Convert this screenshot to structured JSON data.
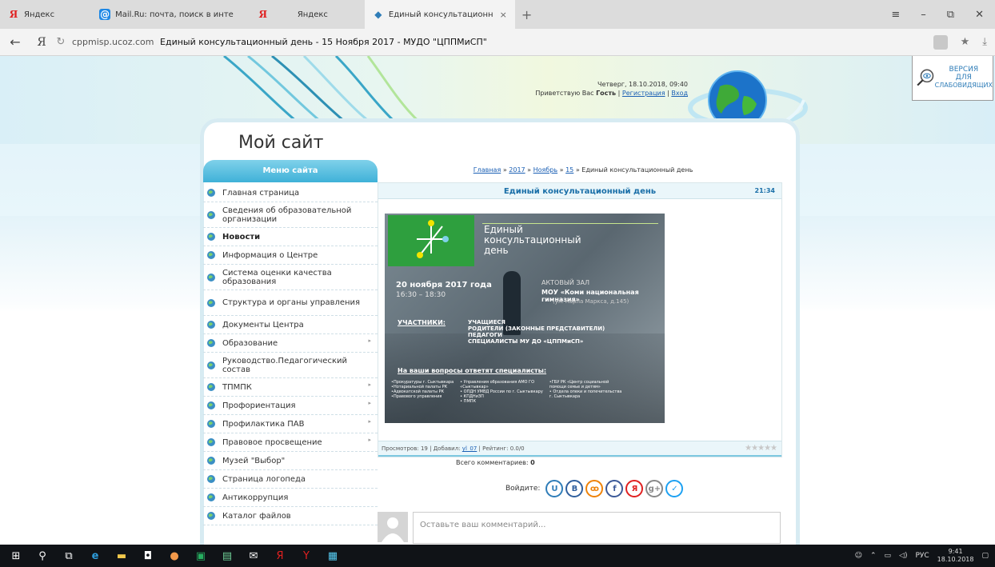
{
  "browser": {
    "tabs": [
      {
        "label": "Яндекс",
        "favicon": "yandex-icon",
        "active": false
      },
      {
        "label": "Mail.Ru: почта, поиск в инте",
        "favicon": "mailru-icon",
        "active": false
      },
      {
        "label": "Яндекс",
        "favicon": "yandex-icon",
        "active": false
      },
      {
        "label": "Единый консультационн",
        "favicon": "site-icon",
        "active": true
      }
    ],
    "address": {
      "domain": "cppmisp.ucoz.com",
      "page_title": "Единый консультационный день - 15 Ноября 2017 - МУДО \"ЦППМиСП\""
    },
    "controls": {
      "menu": "≡",
      "minimize": "–",
      "restore": "⧉",
      "close": "✕",
      "back": "←",
      "ya": "Я",
      "reload": "↻",
      "star": "★",
      "download": "⤓",
      "newtab": "+",
      "tabclose": "×"
    }
  },
  "header": {
    "datetime": "Четверг, 18.10.2018, 09:40",
    "greeting_prefix": "Приветствую Вас",
    "user": "Гость",
    "register": "Регистрация",
    "separator": "|",
    "login": "Вход",
    "vision_line1": "ВЕРСИЯ",
    "vision_line2": "ДЛЯ",
    "vision_line3": "СЛАБОВИДЯЩИХ"
  },
  "site": {
    "title": "Мой сайт"
  },
  "menu": {
    "heading": "Меню сайта",
    "items": [
      {
        "label": "Главная страница",
        "two_line": false,
        "submenu": false,
        "active": false
      },
      {
        "label": "Сведения об образовательной организации",
        "two_line": true,
        "submenu": false,
        "active": false
      },
      {
        "label": "Новости",
        "two_line": false,
        "submenu": false,
        "active": true
      },
      {
        "label": "Информация о Центре",
        "two_line": false,
        "submenu": false,
        "active": false
      },
      {
        "label": "Система оценки качества образования",
        "two_line": true,
        "submenu": false,
        "active": false
      },
      {
        "label": "Структура и органы управления",
        "two_line": true,
        "submenu": false,
        "active": false
      },
      {
        "label": "Документы Центра",
        "two_line": false,
        "submenu": false,
        "active": false
      },
      {
        "label": "Образование",
        "two_line": false,
        "submenu": true,
        "active": false
      },
      {
        "label": "Руководство.Педагогический состав",
        "two_line": true,
        "submenu": false,
        "active": false
      },
      {
        "label": "ТПМПК",
        "two_line": false,
        "submenu": true,
        "active": false
      },
      {
        "label": "Профориентация",
        "two_line": false,
        "submenu": true,
        "active": false
      },
      {
        "label": "Профилактика ПАВ",
        "two_line": false,
        "submenu": true,
        "active": false
      },
      {
        "label": "Правовое просвещение",
        "two_line": false,
        "submenu": true,
        "active": false
      },
      {
        "label": "Музей \"Выбор\"",
        "two_line": false,
        "submenu": false,
        "active": false
      },
      {
        "label": "Страница логопеда",
        "two_line": false,
        "submenu": false,
        "active": false
      },
      {
        "label": "Антикоррупция",
        "two_line": false,
        "submenu": false,
        "active": false
      },
      {
        "label": "Каталог файлов",
        "two_line": false,
        "submenu": false,
        "active": false
      }
    ]
  },
  "breadcrumb": {
    "home": "Главная",
    "year": "2017",
    "month": "Ноябрь",
    "day": "15",
    "current": "Единый консультационный день",
    "sep": "»"
  },
  "article": {
    "title": "Единый консультационный день",
    "time": "21:34",
    "poster": {
      "title_line1": "Единый",
      "title_line2": "консультационный",
      "title_line3": "день",
      "date": "20 ноября 2017 года",
      "time": "16:30 – 18:30",
      "hall": "АКТОВЫЙ ЗАЛ",
      "school": "МОУ «Коми национальная гимназия»",
      "address": "(ул. Карла Маркса, д.145)",
      "participants_label": "УЧАСТНИКИ:",
      "participants": [
        "УЧАЩИЕСЯ",
        "РОДИТЕЛИ (ЗАКОННЫЕ ПРЕДСТАВИТЕЛИ)",
        "ПЕДАГОГИ",
        "СПЕЦИАЛИСТЫ МУ ДО «ЦППМиСП»"
      ],
      "answers_label": "На ваши вопросы ответят специалисты:",
      "orgs_col1": [
        "•Прокуратуры г. Сыктывкара",
        "•Нотариальной палаты РК",
        "•Адвокатской палаты РК",
        "•Правового управления"
      ],
      "orgs_col2": [
        "• Управления образования АМО ГО",
        "«Сыктывкар»",
        "• ОПДН УМВД России по г. Сыктывкару",
        "• КПДНиЗП",
        "• ПМПК"
      ],
      "orgs_col3": [
        "•ГБУ РК «Центр социальной",
        "помощи семье и детям»",
        "• Отдела опеки и попечительства",
        "г. Сыктывкара"
      ]
    },
    "footer": {
      "views_label": "Просмотров:",
      "views": "19",
      "added_label": "Добавил:",
      "author": "yl_07",
      "rating_label": "Рейтинг:",
      "rating": "0.0/0",
      "sep": "|",
      "stars": "★★★★★"
    }
  },
  "comments": {
    "total_label": "Всего комментариев:",
    "total": "0",
    "login_label": "Войдите:",
    "social": [
      {
        "name": "ucoz",
        "glyph": "U",
        "color": "#2f7db8"
      },
      {
        "name": "vk",
        "glyph": "B",
        "color": "#2f5f9e"
      },
      {
        "name": "ok",
        "glyph": "ꝏ",
        "color": "#ee8208"
      },
      {
        "name": "facebook",
        "glyph": "f",
        "color": "#3b5998"
      },
      {
        "name": "yandex",
        "glyph": "Я",
        "color": "#e02020"
      },
      {
        "name": "googleplus",
        "glyph": "g+",
        "color": "#888888"
      },
      {
        "name": "twitter",
        "glyph": "✓",
        "color": "#1da1f2"
      }
    ],
    "placeholder": "Оставьте ваш комментарий..."
  },
  "taskbar": {
    "language": "РУС",
    "time": "9:41",
    "date": "18.10.2018"
  },
  "colors": {
    "accent": "#3fb1d8",
    "link": "#1a5fb4",
    "title": "#1a6fa8"
  }
}
